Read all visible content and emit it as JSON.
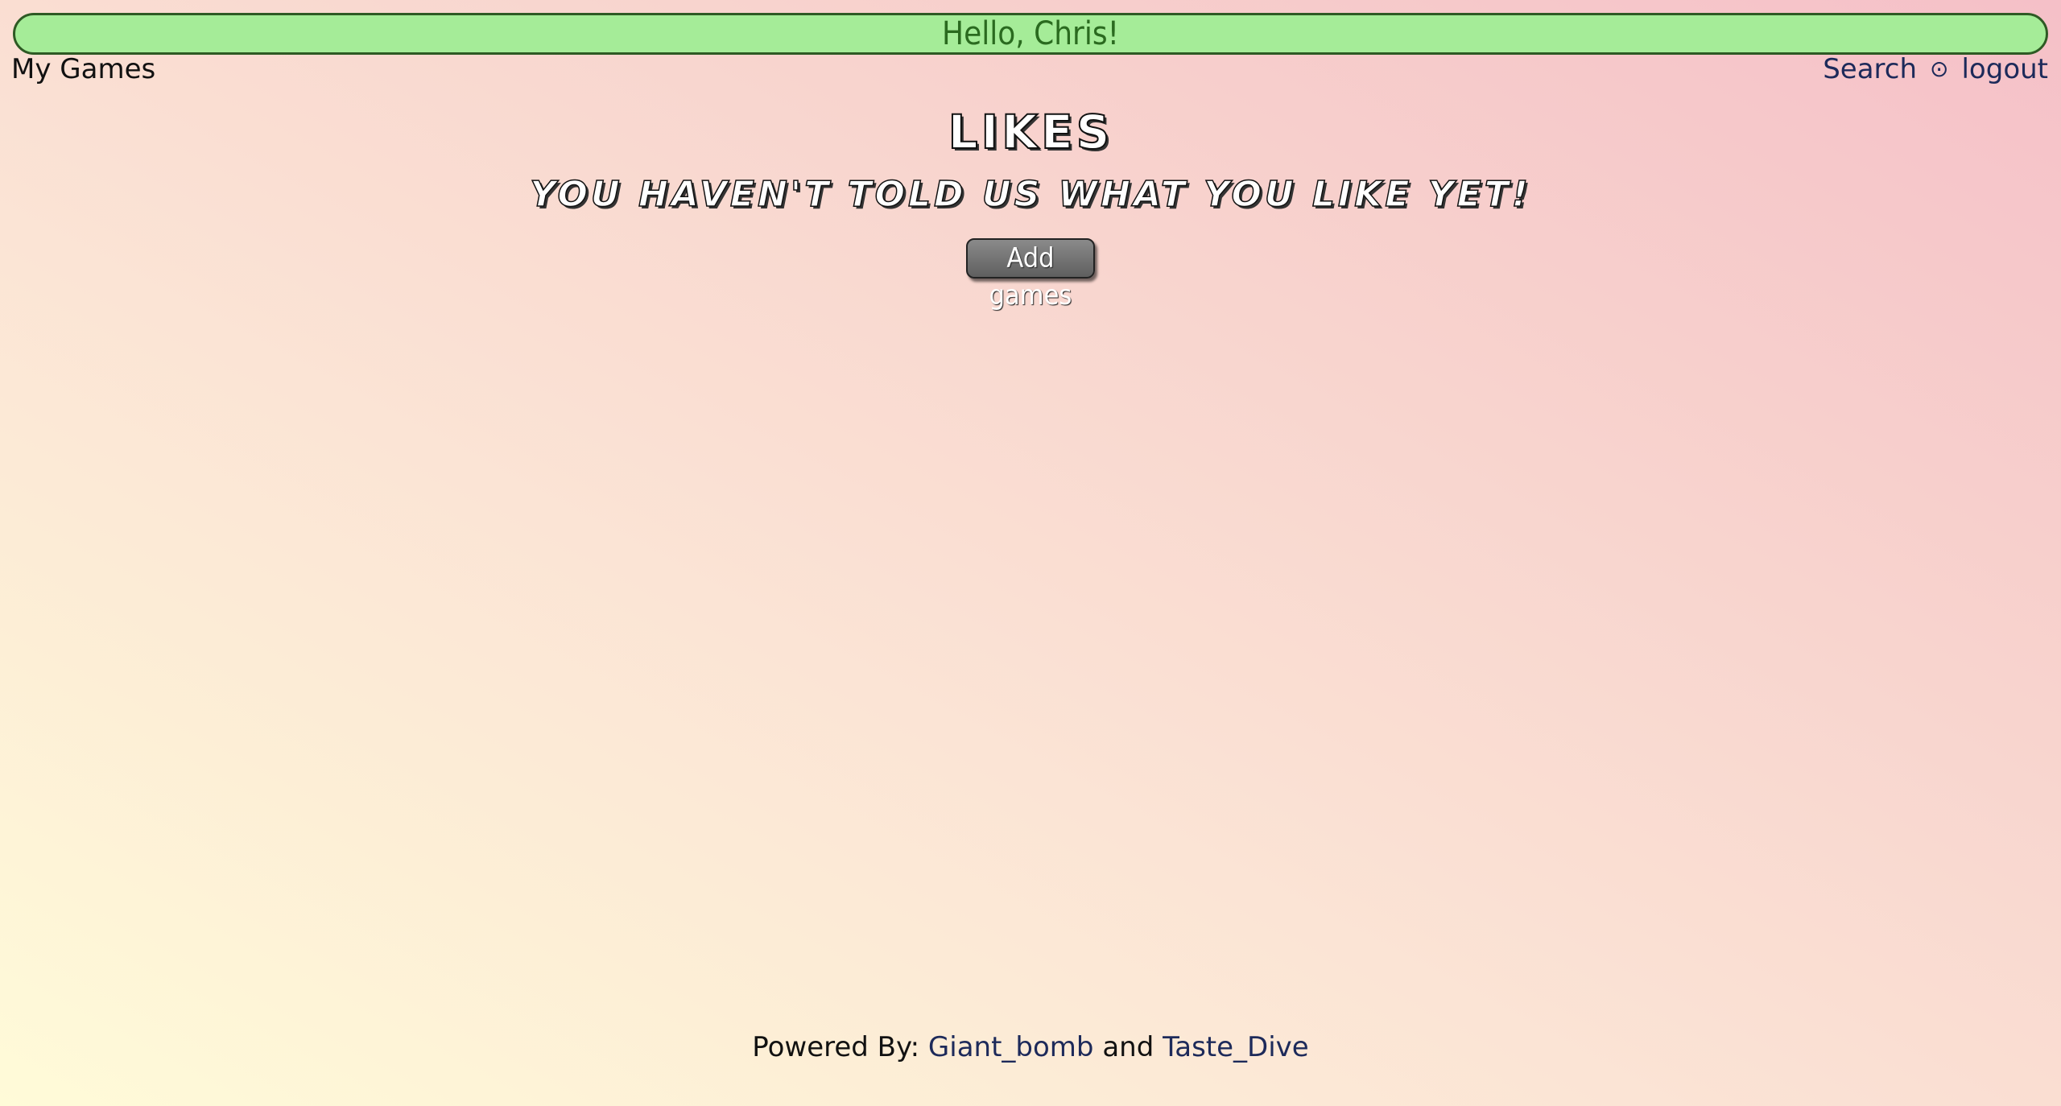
{
  "header": {
    "greeting": "Hello, Chris!"
  },
  "nav": {
    "my_games": "My Games",
    "search": "Search",
    "separator": "⊙",
    "logout": "logout"
  },
  "main": {
    "title": "LIKES",
    "empty_message": "YOU HAVEN'T TOLD US WHAT YOU LIKE YET!",
    "add_button": "Add games"
  },
  "footer": {
    "powered_by": "Powered By:",
    "giant_bomb": "Giant_bomb",
    "and": "and",
    "taste_dive": "Taste_Dive"
  },
  "colors": {
    "greeting_bar_bg": "#a5ec98",
    "greeting_bar_border": "#2e5a24",
    "greeting_text": "#2a6a1f",
    "link": "#1d2a5a",
    "button_bg": "#6f6f6f",
    "background_top_right": "#f5c0c8",
    "background_bottom_left": "#fffbd8"
  }
}
